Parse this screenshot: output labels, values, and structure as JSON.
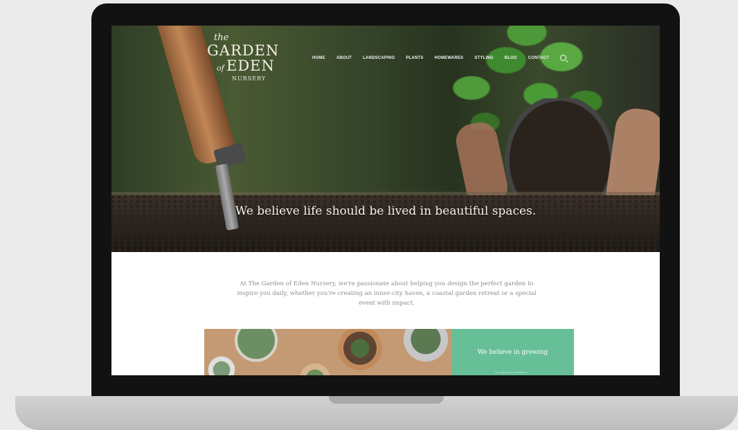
{
  "site": {
    "logo": {
      "the": "the",
      "garden": "GARDEN",
      "of": "of",
      "eden": "EDEN",
      "nursery": "NURSERY"
    },
    "nav": [
      "HOME",
      "ABOUT",
      "LANDSCAPING",
      "PLANTS",
      "HOMEWARES",
      "STYLING",
      "BLOG",
      "CONTACT"
    ],
    "hero": {
      "tagline": "We believe life should be lived in beautiful spaces."
    },
    "intro": {
      "lines": [
        "At The Garden of Eden Nursery, we're passionate about helping you design the perfect garden to",
        "inspire you daily, whether you're creating an inner-city haven, a coastal garden retreat or a special",
        "event with impact."
      ]
    },
    "feature": {
      "heading": "We believe in growing",
      "subtext": "Let's give you a canvas to ..."
    }
  },
  "colors": {
    "accent_green": "#67bf97",
    "laptop_frame": "#121212",
    "background": "#ebebeb"
  }
}
